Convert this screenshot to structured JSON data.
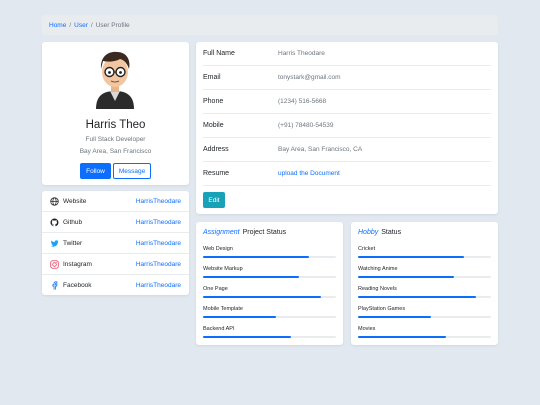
{
  "breadcrumb": {
    "home": "Home",
    "user": "User",
    "current": "User Profile",
    "sep": "/"
  },
  "profile": {
    "name": "Harris Theo",
    "title": "Full Stack Developer",
    "location": "Bay Area, San Francisco",
    "follow_label": "Follow",
    "message_label": "Message"
  },
  "social": [
    {
      "label": "Website",
      "value": "HarrisTheodare",
      "icon": "globe-icon"
    },
    {
      "label": "Github",
      "value": "HarrisTheodare",
      "icon": "github-icon"
    },
    {
      "label": "Twitter",
      "value": "HarrisTheodare",
      "icon": "twitter-icon"
    },
    {
      "label": "Instagram",
      "value": "HarrisTheodare",
      "icon": "instagram-icon"
    },
    {
      "label": "Facebook",
      "value": "HarrisTheodare",
      "icon": "facebook-icon"
    }
  ],
  "details": [
    {
      "key": "Full Name",
      "value": "Harris Theodare"
    },
    {
      "key": "Email",
      "value": "tonystark@gmail.com"
    },
    {
      "key": "Phone",
      "value": "(1234) 516-5668"
    },
    {
      "key": "Mobile",
      "value": "(+91) 78480-54539"
    },
    {
      "key": "Address",
      "value": "Bay Area, San Francisco, CA"
    },
    {
      "key": "Resume",
      "value": "upload the Document"
    }
  ],
  "edit_label": "Edit",
  "assignment": {
    "accent": "Assignment",
    "title": "Project Status",
    "items": [
      {
        "label": "Web Design",
        "percent": 80
      },
      {
        "label": "Website Markup",
        "percent": 72
      },
      {
        "label": "One Page",
        "percent": 89
      },
      {
        "label": "Mobile Template",
        "percent": 55
      },
      {
        "label": "Backend API",
        "percent": 66
      }
    ]
  },
  "hobby": {
    "accent": "Hobby",
    "title": "Status",
    "items": [
      {
        "label": "Cricket",
        "percent": 80
      },
      {
        "label": "Watching Anime",
        "percent": 72
      },
      {
        "label": "Reading Novels",
        "percent": 89
      },
      {
        "label": "PlayStation Games",
        "percent": 55
      },
      {
        "label": "Movies",
        "percent": 66
      }
    ]
  },
  "colors": {
    "accent": "#0d6efd",
    "edit": "#17a2b8",
    "background": "#e2e8f0"
  }
}
